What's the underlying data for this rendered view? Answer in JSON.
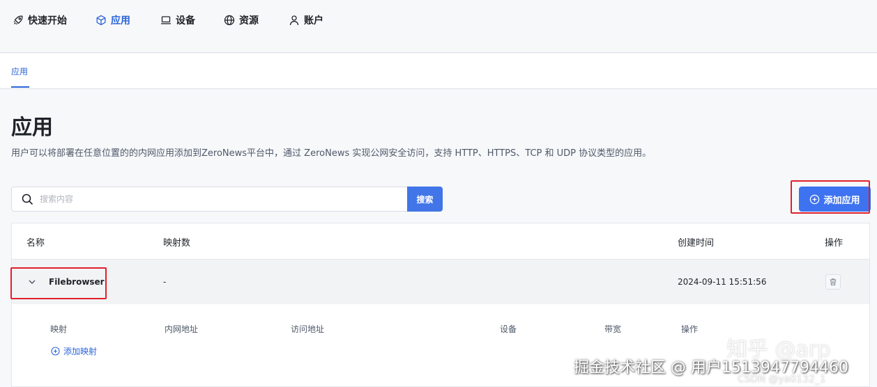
{
  "nav": {
    "items": [
      {
        "label": "快速开始",
        "icon": "rocket-icon"
      },
      {
        "label": "应用",
        "icon": "cube-icon",
        "active": true
      },
      {
        "label": "设备",
        "icon": "laptop-icon"
      },
      {
        "label": "资源",
        "icon": "globe-icon"
      },
      {
        "label": "账户",
        "icon": "user-icon"
      }
    ]
  },
  "subtabs": {
    "active": "应用"
  },
  "page": {
    "title": "应用",
    "description": "用户可以将部署在任意位置的的内网应用添加到ZeroNews平台中，通过 ZeroNews 实现公网安全访问，支持 HTTP、HTTPS、TCP 和 UDP 协议类型的应用。"
  },
  "search": {
    "placeholder": "搜索内容",
    "value": "",
    "button": "搜索"
  },
  "add_app_button": "添加应用",
  "table": {
    "headers": {
      "name": "名称",
      "mappings": "映射数",
      "created": "创建时间",
      "actions": "操作"
    },
    "rows": [
      {
        "name": "Filebrowser",
        "mappings": "-",
        "created": "2024-09-11 15:51:56"
      }
    ]
  },
  "subtable": {
    "headers": {
      "mapping": "映射",
      "intranet": "内网地址",
      "access": "访问地址",
      "device": "设备",
      "bandwidth": "带宽",
      "actions": "操作"
    },
    "add_mapping": "添加映射"
  },
  "watermarks": {
    "zhihu": "知乎 @arp",
    "juejin": "掘金技术社区 @ 用户1513947794460",
    "csdn": "CSDN @ya0132_1"
  },
  "colors": {
    "accent": "#2b64d9",
    "button": "#3d73f0",
    "highlight": "#e0202a"
  }
}
